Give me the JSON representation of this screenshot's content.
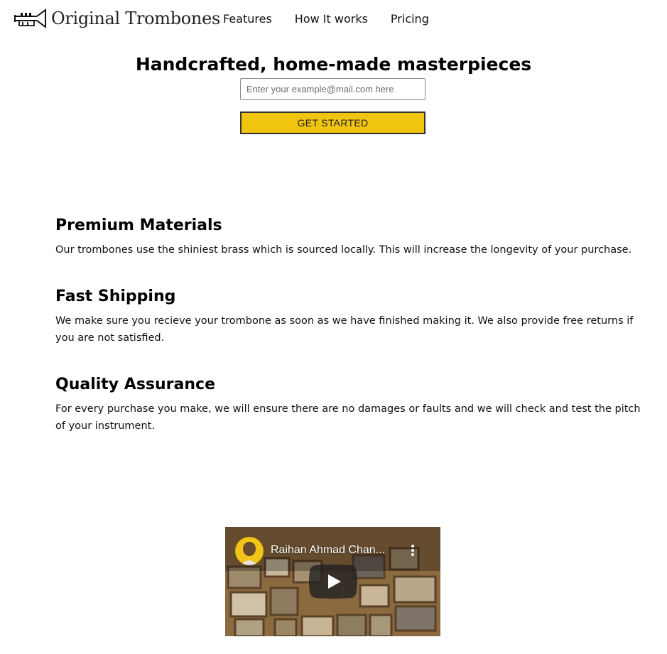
{
  "header": {
    "logo_text": "Original Trombones",
    "nav": [
      {
        "label": "Features"
      },
      {
        "label": "How It works"
      },
      {
        "label": "Pricing"
      }
    ]
  },
  "hero": {
    "title": "Handcrafted, home-made masterpieces",
    "email_placeholder": "Enter your example@mail.com here",
    "email_value": "",
    "cta_label": "GET STARTED"
  },
  "features": [
    {
      "title": "Premium Materials",
      "text": "Our trombones use the shiniest brass which is sourced locally. This will increase the longevity of your purchase."
    },
    {
      "title": "Fast Shipping",
      "text": "We make sure you recieve your trombone as soon as we have finished making it. We also provide free returns if you are not satisfied."
    },
    {
      "title": "Quality Assurance",
      "text": "For every purchase you make, we will ensure there are no damages or faults and we will check and test the pitch of your instrument."
    }
  ],
  "video": {
    "title": "Raihan Ahmad Chan...",
    "icons": [
      "avatar",
      "more-vert-icon",
      "play-icon"
    ]
  },
  "colors": {
    "accent": "#f1c40f",
    "play_button": "#212121"
  }
}
